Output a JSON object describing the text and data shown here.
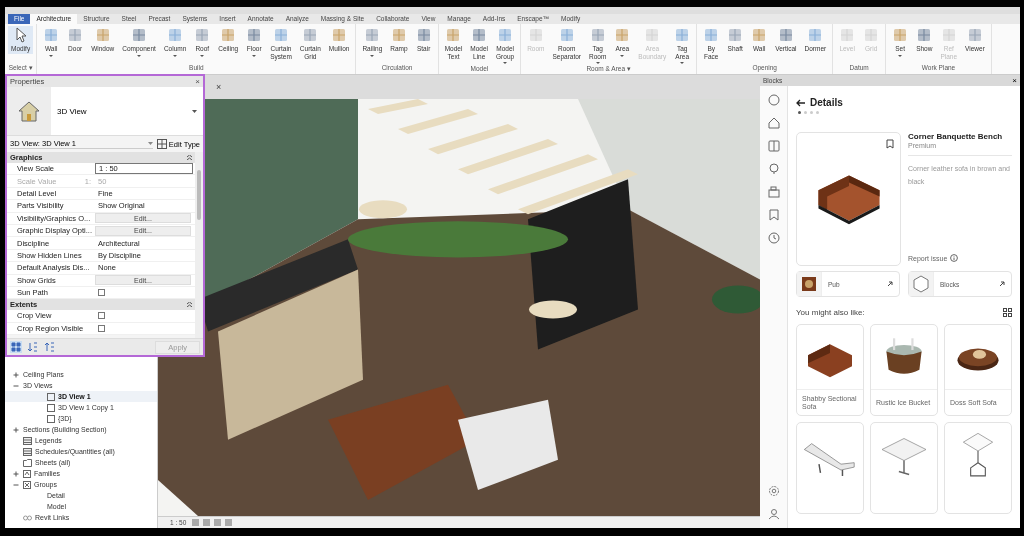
{
  "tabs": [
    {
      "label": "File",
      "selected": false,
      "kind": "file"
    },
    {
      "label": "Architecture",
      "selected": true
    },
    {
      "label": "Structure",
      "selected": false
    },
    {
      "label": "Steel",
      "selected": false
    },
    {
      "label": "Precast",
      "selected": false
    },
    {
      "label": "Systems",
      "selected": false
    },
    {
      "label": "Insert",
      "selected": false
    },
    {
      "label": "Annotate",
      "selected": false
    },
    {
      "label": "Analyze",
      "selected": false
    },
    {
      "label": "Massing & Site",
      "selected": false
    },
    {
      "label": "Collaborate",
      "selected": false
    },
    {
      "label": "View",
      "selected": false
    },
    {
      "label": "Manage",
      "selected": false
    },
    {
      "label": "Add-Ins",
      "selected": false
    },
    {
      "label": "Enscape™",
      "selected": false
    },
    {
      "label": "Modify",
      "selected": false
    }
  ],
  "ribbon": {
    "panels": [
      {
        "label": "Select ▾",
        "tools": [
          {
            "label": "Modify",
            "selected": true,
            "disabled": false,
            "dropdown": false
          }
        ]
      },
      {
        "label": "Build",
        "tools": [
          {
            "label": "Wall",
            "selected": false,
            "disabled": false,
            "dropdown": true
          },
          {
            "label": "Door",
            "selected": false,
            "disabled": false,
            "dropdown": false
          },
          {
            "label": "Window",
            "selected": false,
            "disabled": false,
            "dropdown": false
          },
          {
            "label": "Component",
            "selected": false,
            "disabled": false,
            "dropdown": true
          },
          {
            "label": "Column",
            "selected": false,
            "disabled": false,
            "dropdown": true
          },
          {
            "label": "Roof",
            "selected": false,
            "disabled": false,
            "dropdown": true
          },
          {
            "label": "Ceiling",
            "selected": false,
            "disabled": false,
            "dropdown": false
          },
          {
            "label": "Floor",
            "selected": false,
            "disabled": false,
            "dropdown": true
          },
          {
            "label": "Curtain System",
            "selected": false,
            "disabled": false,
            "dropdown": false
          },
          {
            "label": "Curtain Grid",
            "selected": false,
            "disabled": false,
            "dropdown": false
          },
          {
            "label": "Mullion",
            "selected": false,
            "disabled": false,
            "dropdown": false
          }
        ]
      },
      {
        "label": "Circulation",
        "tools": [
          {
            "label": "Railing",
            "selected": false,
            "disabled": false,
            "dropdown": true
          },
          {
            "label": "Ramp",
            "selected": false,
            "disabled": false,
            "dropdown": false
          },
          {
            "label": "Stair",
            "selected": false,
            "disabled": false,
            "dropdown": false
          }
        ]
      },
      {
        "label": "Model",
        "tools": [
          {
            "label": "Model Text",
            "selected": false,
            "disabled": false,
            "dropdown": false
          },
          {
            "label": "Model Line",
            "selected": false,
            "disabled": false,
            "dropdown": false
          },
          {
            "label": "Model Group",
            "selected": false,
            "disabled": false,
            "dropdown": true
          }
        ]
      },
      {
        "label": "Room & Area ▾",
        "tools": [
          {
            "label": "Room",
            "selected": false,
            "disabled": true,
            "dropdown": false
          },
          {
            "label": "Room Separator",
            "selected": false,
            "disabled": false,
            "dropdown": false
          },
          {
            "label": "Tag Room",
            "selected": false,
            "disabled": false,
            "dropdown": true
          },
          {
            "label": "Area",
            "selected": false,
            "disabled": false,
            "dropdown": true
          },
          {
            "label": "Area Boundary",
            "selected": false,
            "disabled": true,
            "dropdown": false
          },
          {
            "label": "Tag Area",
            "selected": false,
            "disabled": false,
            "dropdown": true
          }
        ]
      },
      {
        "label": "Opening",
        "tools": [
          {
            "label": "By Face",
            "selected": false,
            "disabled": false,
            "dropdown": false
          },
          {
            "label": "Shaft",
            "selected": false,
            "disabled": false,
            "dropdown": false
          },
          {
            "label": "Wall",
            "selected": false,
            "disabled": false,
            "dropdown": false
          },
          {
            "label": "Vertical",
            "selected": false,
            "disabled": false,
            "dropdown": false
          },
          {
            "label": "Dormer",
            "selected": false,
            "disabled": false,
            "dropdown": false
          }
        ]
      },
      {
        "label": "Datum",
        "tools": [
          {
            "label": "Level",
            "selected": false,
            "disabled": true,
            "dropdown": false
          },
          {
            "label": "Grid",
            "selected": false,
            "disabled": true,
            "dropdown": false
          }
        ]
      },
      {
        "label": "Work Plane",
        "tools": [
          {
            "label": "Set",
            "selected": false,
            "disabled": false,
            "dropdown": true
          },
          {
            "label": "Show",
            "selected": false,
            "disabled": false,
            "dropdown": false
          },
          {
            "label": "Ref Plane",
            "selected": false,
            "disabled": true,
            "dropdown": false
          },
          {
            "label": "Viewer",
            "selected": false,
            "disabled": false,
            "dropdown": false
          }
        ]
      }
    ]
  },
  "properties": {
    "title": "Properties",
    "close": "×",
    "type": "3D View",
    "view": "3D View: 3D View 1",
    "edit_type": "Edit Type",
    "groups": [
      {
        "label": "Graphics",
        "rows": [
          {
            "name": "View Scale",
            "kind": "input",
            "value": "1 : 50"
          },
          {
            "name": "Scale Value",
            "kind": "readonly",
            "prefix": "1:",
            "value": "50"
          },
          {
            "name": "Detail Level",
            "kind": "text",
            "value": "Fine"
          },
          {
            "name": "Parts Visibility",
            "kind": "text",
            "value": "Show Original"
          },
          {
            "name": "Visibility/Graphics O...",
            "kind": "button",
            "value": "Edit..."
          },
          {
            "name": "Graphic Display Opti...",
            "kind": "button",
            "value": "Edit..."
          },
          {
            "name": "Discipline",
            "kind": "text",
            "value": "Architectural"
          },
          {
            "name": "Show Hidden Lines",
            "kind": "text",
            "value": "By Discipline"
          },
          {
            "name": "Default Analysis Dis...",
            "kind": "text",
            "value": "None"
          },
          {
            "name": "Show Grids",
            "kind": "button",
            "value": "Edit..."
          },
          {
            "name": "Sun Path",
            "kind": "checkbox",
            "checked": false
          }
        ]
      },
      {
        "label": "Extents",
        "rows": [
          {
            "name": "Crop View",
            "kind": "checkbox",
            "checked": false
          },
          {
            "name": "Crop Region Visible",
            "kind": "checkbox",
            "checked": false
          }
        ]
      }
    ],
    "sort_modes": [
      {
        "selected": true
      },
      {
        "selected": false
      },
      {
        "selected": false
      }
    ],
    "apply": {
      "label": "Apply",
      "disabled": true
    }
  },
  "project_browser": {
    "items": [
      {
        "label": "Ceiling Plans",
        "kind": "folder",
        "expanded": false,
        "selected": false
      },
      {
        "label": "3D Views",
        "kind": "folder",
        "expanded": true,
        "selected": false,
        "children": [
          {
            "label": "3D View 1",
            "kind": "view",
            "selected": true
          },
          {
            "label": "3D View 1 Copy 1",
            "kind": "view",
            "selected": false
          },
          {
            "label": "{3D}",
            "kind": "view",
            "selected": false
          }
        ]
      },
      {
        "label": "Sections (Building Section)",
        "kind": "folder",
        "expanded": false,
        "selected": false
      },
      {
        "label": "Legends",
        "kind": "legend",
        "selected": false
      },
      {
        "label": "Schedules/Quantities (all)",
        "kind": "schedule",
        "selected": false
      },
      {
        "label": "Sheets (all)",
        "kind": "sheet",
        "selected": false
      },
      {
        "label": "Families",
        "kind": "family",
        "expanded": false,
        "selected": false
      },
      {
        "label": "Groups",
        "kind": "group",
        "expanded": true,
        "selected": false,
        "children": [
          {
            "label": "Detail",
            "kind": "plain",
            "selected": false
          },
          {
            "label": "Model",
            "kind": "plain",
            "selected": false
          }
        ]
      },
      {
        "label": "Revit Links",
        "kind": "link",
        "selected": false
      }
    ]
  },
  "viewport": {
    "close": "×",
    "scale": "1 : 50"
  },
  "blocks": {
    "title": "Blocks",
    "close": "×",
    "heading": "Details",
    "pager": [
      {
        "selected": true
      },
      {
        "selected": false
      },
      {
        "selected": false
      },
      {
        "selected": false
      }
    ],
    "item": {
      "title": "Corner Banquette Bench",
      "tier": "Premium",
      "description": "Corner leather sofa in brown and black",
      "report": "Report issue",
      "kind": "corner"
    },
    "links": [
      {
        "label": "Pub",
        "kind": "pub"
      },
      {
        "label": "Blocks",
        "kind": "blocks"
      }
    ],
    "suggestions_title": "You might also like:",
    "suggestions": [
      {
        "name": "Shabby Sectional Sofa",
        "kind": "sofa"
      },
      {
        "name": "Rustic Ice Bucket",
        "kind": "bucket"
      },
      {
        "name": "Doss Soft Sofa",
        "kind": "round"
      },
      {
        "kind": "lounger"
      },
      {
        "kind": "table"
      },
      {
        "kind": "side_table"
      }
    ]
  }
}
